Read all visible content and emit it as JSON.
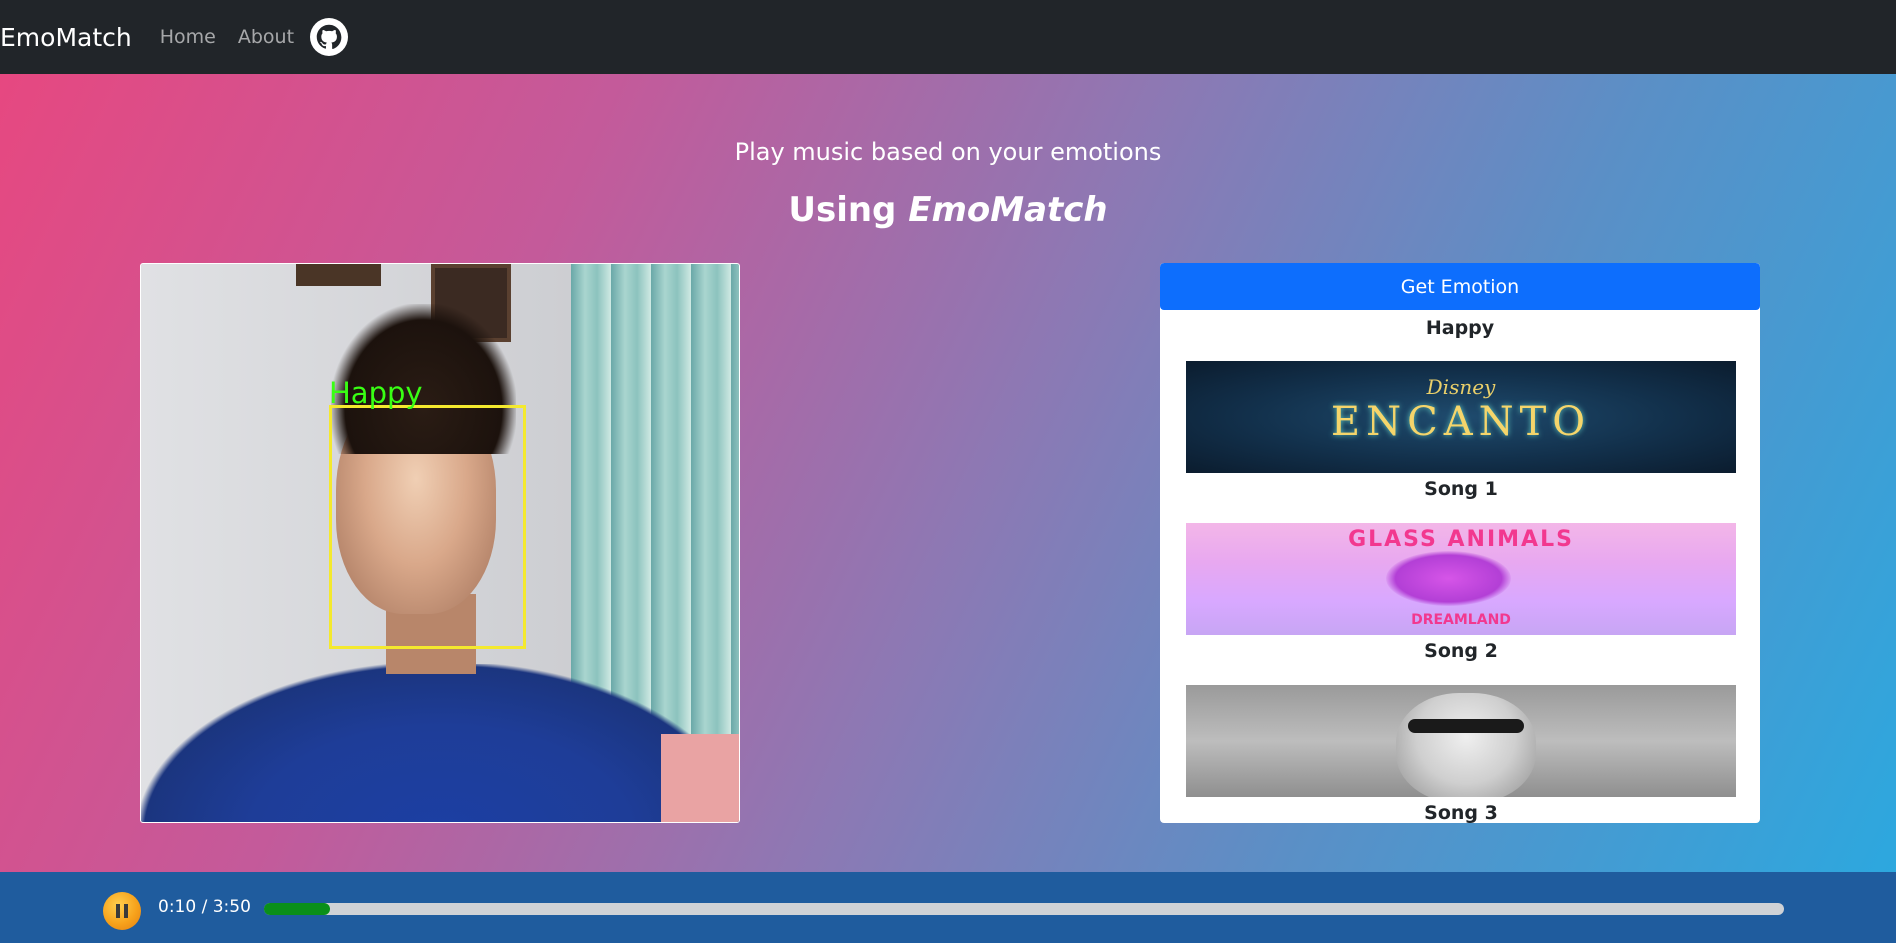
{
  "navbar": {
    "brand": "EmoMatch",
    "links": [
      "Home",
      "About"
    ],
    "github_icon": "github-icon"
  },
  "hero": {
    "subtitle": "Play music based on your emotions",
    "heading_prefix": "Using ",
    "heading_emphasis": "EmoMatch"
  },
  "webcam": {
    "detected_label": "Happy",
    "box_color": "#f4e92e",
    "label_color": "#39ff14"
  },
  "panel": {
    "button_label": "Get Emotion",
    "emotion": "Happy",
    "songs": [
      {
        "label": "Song 1",
        "thumbnail_text": "ENCANTO",
        "thumbnail_sub": "Disney"
      },
      {
        "label": "Song 2",
        "thumbnail_text": "GLASS ANIMALS",
        "thumbnail_sub": "DREAMLAND"
      },
      {
        "label": "Song 3"
      }
    ],
    "accent": "#0d6efd"
  },
  "player": {
    "time": "0:10 / 3:50",
    "progress": 0.0435,
    "progress_color": "#0a8f1a",
    "button_icon": "pause-icon"
  }
}
